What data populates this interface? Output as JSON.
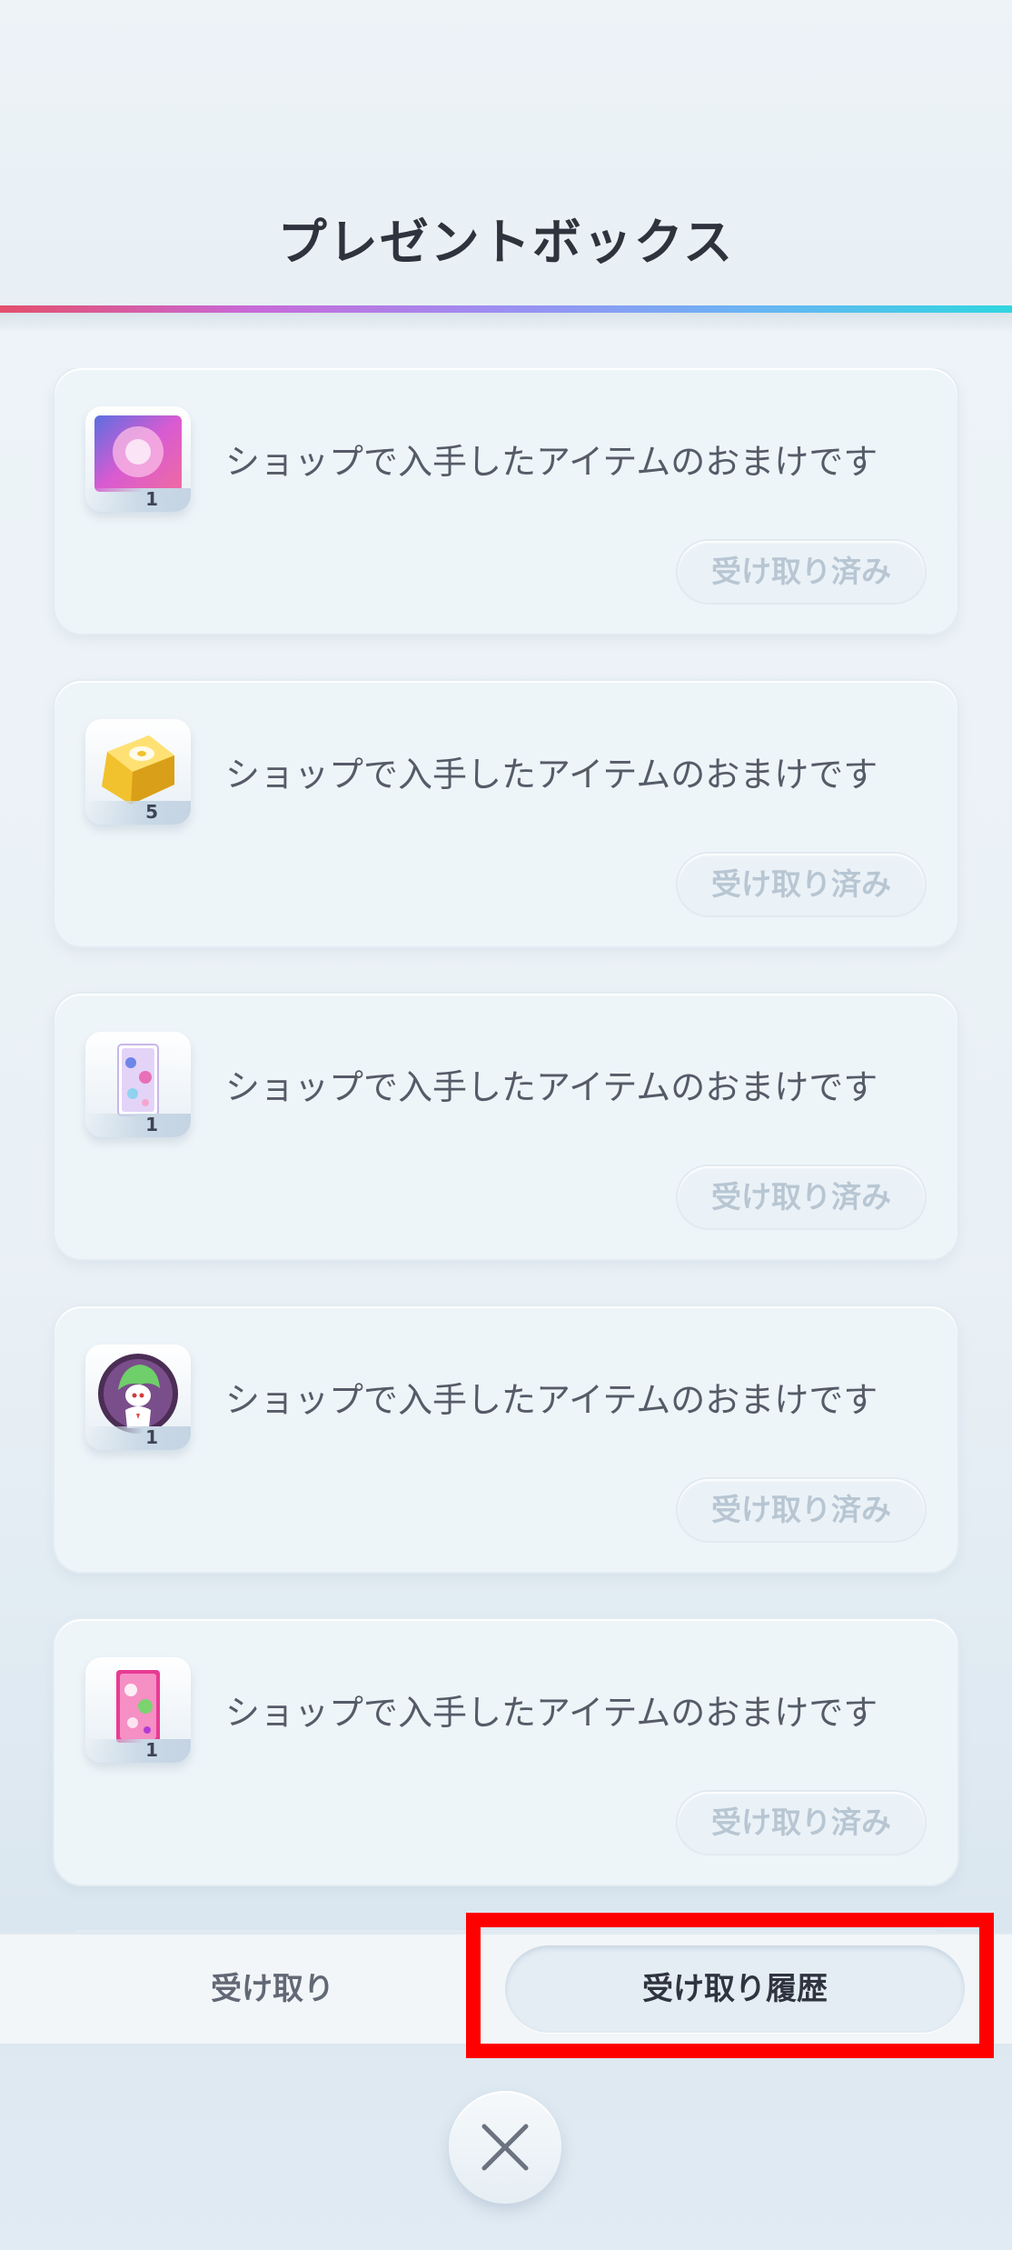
{
  "header": {
    "title": "プレゼントボックス"
  },
  "items": [
    {
      "icon": "rainbow-card-icon",
      "count": "1",
      "message": "ショップで入手したアイテムのおまけです",
      "status": "受け取り済み"
    },
    {
      "icon": "gold-bar-icon",
      "count": "5",
      "message": "ショップで入手したアイテムのおまけです",
      "status": "受け取り済み"
    },
    {
      "icon": "card-sleeve-icon",
      "count": "1",
      "message": "ショップで入手したアイテムのおまけです",
      "status": "受け取り済み"
    },
    {
      "icon": "gardevoir-coin-icon",
      "count": "1",
      "message": "ショップで入手したアイテムのおまけです",
      "status": "受け取り済み"
    },
    {
      "icon": "pink-card-icon",
      "count": "1",
      "message": "ショップで入手したアイテムのおまけです",
      "status": "受け取り済み"
    }
  ],
  "tabs": {
    "receive": "受け取り",
    "history": "受け取り履歴",
    "selected": "history"
  },
  "footer": {
    "close_icon": "close-icon"
  },
  "colors": {
    "highlight": "#ff0000",
    "title_text": "#2f333d",
    "claimed_text": "#b8c6d3"
  }
}
